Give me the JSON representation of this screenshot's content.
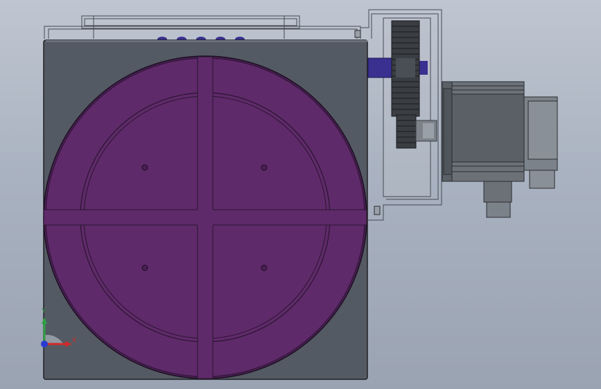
{
  "viewport": {
    "background_top": "#bfc6d1",
    "background_bottom": "#9aa3b2"
  },
  "model": {
    "housing_color": "#545a63",
    "housing_outline": "#1e2024",
    "table_color": "#5f2a6a",
    "table_dark": "#4a1f55",
    "gear_color": "#3a3d42",
    "shaft_color": "#3a3090",
    "motor_color": "#5b6066",
    "motor_light": "#8a9097",
    "cover_line": "#454a52"
  },
  "triad": {
    "y_label": "Y",
    "x_label": "X",
    "y_color": "#2ea043",
    "x_color": "#d22a2a",
    "z_color": "#2a3bd2"
  }
}
